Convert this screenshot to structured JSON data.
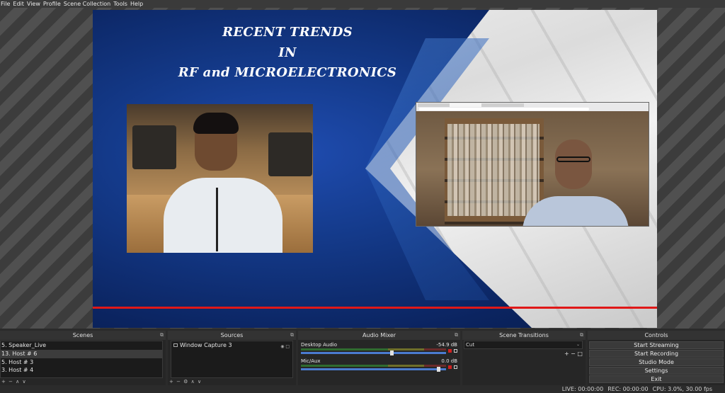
{
  "menu": [
    "File",
    "Edit",
    "View",
    "Profile",
    "Scene Collection",
    "Tools",
    "Help"
  ],
  "preview": {
    "title_lines": [
      "RECENT TRENDS",
      "IN",
      "RF and MICROELECTRONICS"
    ]
  },
  "docks": {
    "scenes": {
      "title": "Scenes",
      "items": [
        "5. Speaker_Live",
        "13. Host # 6",
        "5. Host # 3",
        "3. Host # 4"
      ],
      "footer": "+ − ∧ ∨"
    },
    "sources": {
      "title": "Sources",
      "items": [
        "Window Capture 3"
      ],
      "footer": "+ − ⚙ ∧ ∨"
    },
    "mixer": {
      "title": "Audio Mixer",
      "channels": [
        {
          "name": "Desktop Audio",
          "db": "-54.9 dB",
          "level": 0.0,
          "volume": 0.63
        },
        {
          "name": "Mic/Aux",
          "db": "0.0 dB",
          "level": 0.0,
          "volume": 0.96
        }
      ]
    },
    "transitions": {
      "title": "Scene Transitions",
      "selected": "Cut",
      "add_label": "+ − □"
    },
    "controls": {
      "title": "Controls",
      "buttons": [
        "Start Streaming",
        "Start Recording",
        "Studio Mode",
        "Settings",
        "Exit"
      ]
    }
  },
  "status": {
    "live": "LIVE: 00:00:00",
    "rec": "REC: 00:00:00",
    "cpu": "CPU: 3.0%, 30.00 fps"
  }
}
